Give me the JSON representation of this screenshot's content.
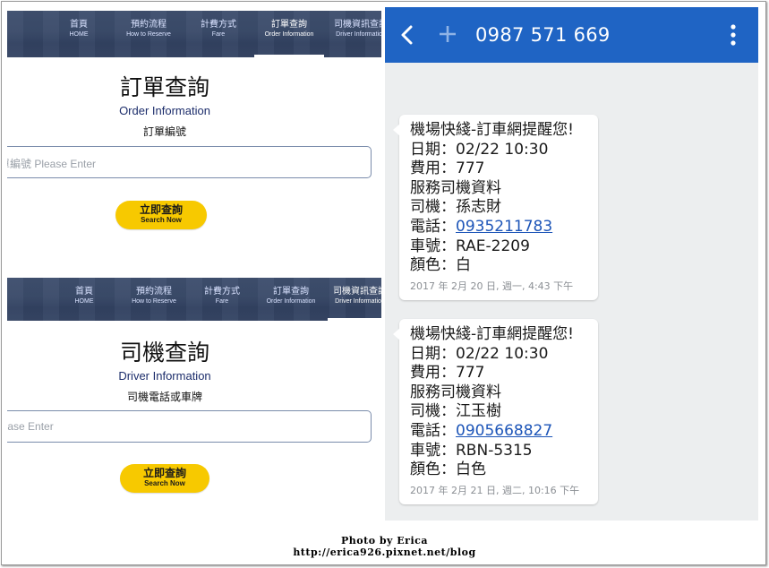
{
  "web": {
    "nav": [
      {
        "zh": "首頁",
        "en": "HOME"
      },
      {
        "zh": "預約流程",
        "en": "How to Reserve"
      },
      {
        "zh": "計費方式",
        "en": "Fare"
      },
      {
        "zh": "訂單查詢",
        "en": "Order Information"
      },
      {
        "zh": "司機資訊查詢",
        "en": "Driver Information"
      }
    ],
    "order": {
      "title": "訂單查詢",
      "subtitle": "Order Information",
      "field_label": "訂單編號",
      "placeholder": "單編號 Please Enter",
      "button_zh": "立即查詢",
      "button_en": "Search Now"
    },
    "driver": {
      "title": "司機查詢",
      "subtitle": "Driver Information",
      "field_label": "司機電話或車牌",
      "placeholder": "lease Enter",
      "button_zh": "立即查詢",
      "button_en": "Search Now"
    }
  },
  "sms": {
    "contact_number": "0987 571 669",
    "messages": [
      {
        "header": "機場快綫-訂車網提醒您!",
        "date_line": "日期：02/22 10:30",
        "fee_line": "費用：777",
        "section_line": "服務司機資料",
        "driver_line": "司機：孫志財",
        "phone_label": "電話：",
        "phone": "0935211783",
        "plate_line": "車號：RAE-2209",
        "color_line": "顏色：白",
        "timestamp": "2017 年 2月 20 日, 週一, 4:43 下午"
      },
      {
        "header": "機場快綫-訂車網提醒您!",
        "date_line": "日期：02/22 10:30",
        "fee_line": "費用：777",
        "section_line": "服務司機資料",
        "driver_line": "司機：江玉樹",
        "phone_label": "電話：",
        "phone": "0905668827",
        "plate_line": "車號：RBN-5315",
        "color_line": "顏色：白色",
        "timestamp": "2017 年 2月 21 日, 週二, 10:16 下午"
      }
    ]
  },
  "watermark": {
    "line1": "Photo by Erica",
    "line2": "http://erica926.pixnet.net/blog"
  },
  "colors": {
    "appbar": "#1f64c4",
    "button": "#f7c900",
    "link": "#1d55b8"
  },
  "icons": [
    "back-arrow-icon",
    "plus-icon",
    "more-vert-icon"
  ]
}
